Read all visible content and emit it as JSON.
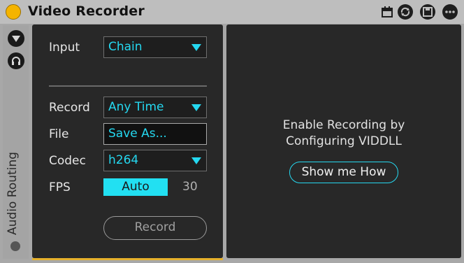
{
  "device": {
    "title": "Video Recorder",
    "power_color": "#f5b400"
  },
  "titlebar_icons": [
    "tempo-sync-icon",
    "hot-swap-icon",
    "save-preset-icon",
    "more-options-icon"
  ],
  "sidebar": {
    "label": "Audio Routing",
    "buttons": [
      "collapse-arrow-icon",
      "headphones-icon"
    ]
  },
  "controls": {
    "input_label": "Input",
    "input_value": "Chain",
    "record_label": "Record",
    "record_value": "Any Time",
    "file_label": "File",
    "file_value": "Save As...",
    "codec_label": "Codec",
    "codec_value": "h264",
    "fps_label": "FPS",
    "fps_mode": "Auto",
    "fps_value": "30",
    "record_button": "Record"
  },
  "info": {
    "line1": "Enable Recording by",
    "line2": "Configuring VIDDLL",
    "show_button": "Show me How"
  },
  "colors": {
    "accent": "#25d8f0",
    "panel_bg": "#282828",
    "titlebar_bg": "#bebebe"
  }
}
